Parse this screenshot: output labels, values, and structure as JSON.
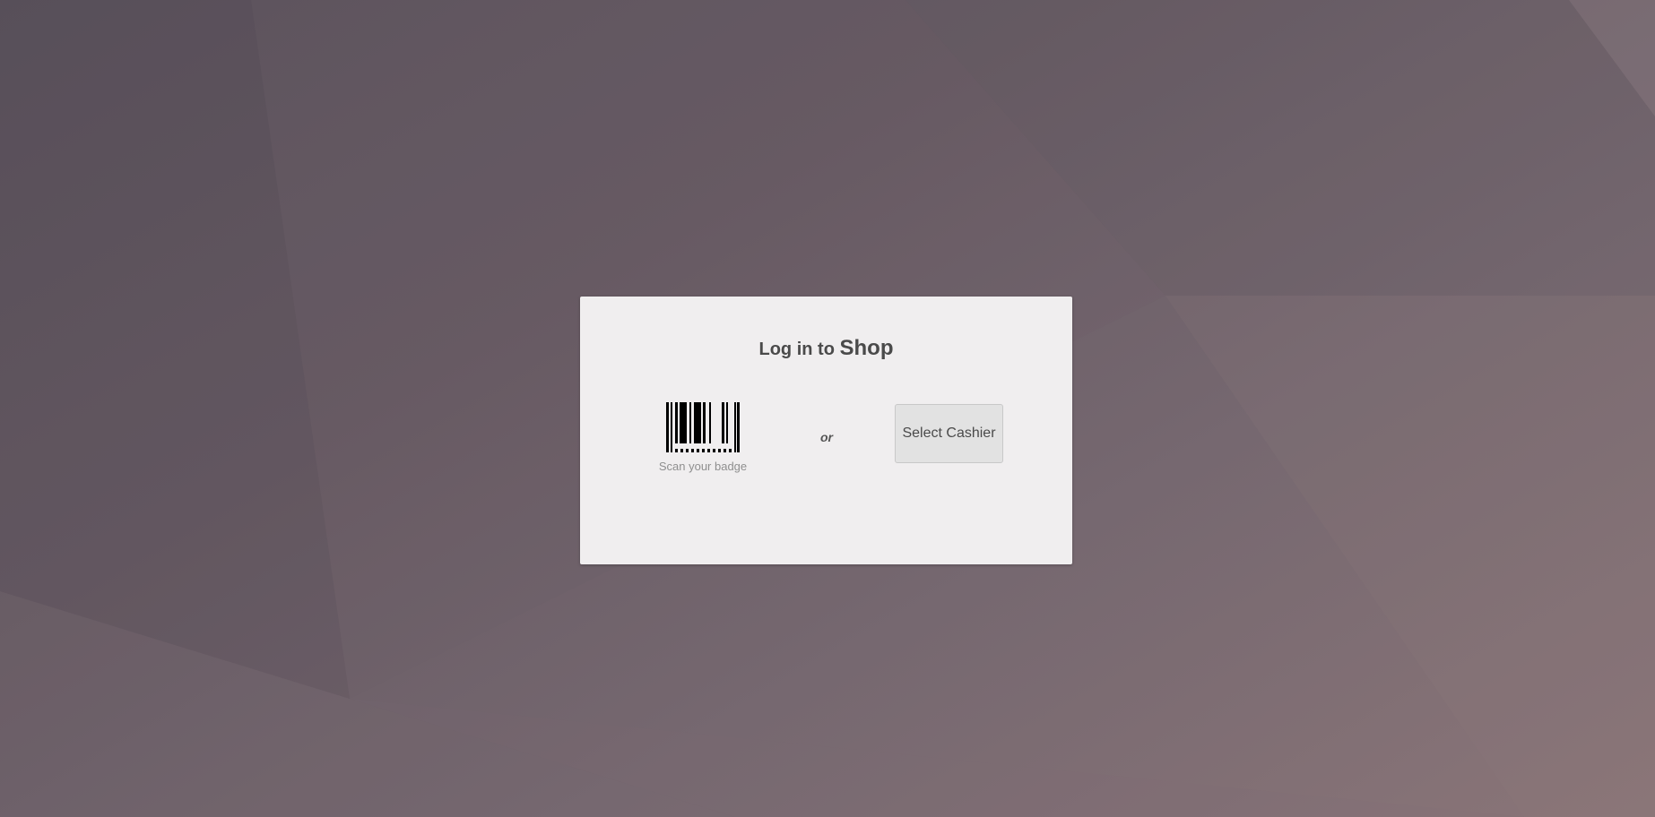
{
  "colors": {
    "card_background": "#f0eeef",
    "title_text": "#4a4a4a",
    "muted_text": "#8f8f8f",
    "button_background": "#e2e2e2",
    "background_start": "#5a525c",
    "background_end": "#8a7578"
  },
  "login": {
    "title_prefix": "Log in to",
    "shop_name": "Shop",
    "badge_icon": "barcode-icon",
    "badge_label": "Scan your badge",
    "separator": "or",
    "select_cashier_label": "Select Cashier"
  }
}
